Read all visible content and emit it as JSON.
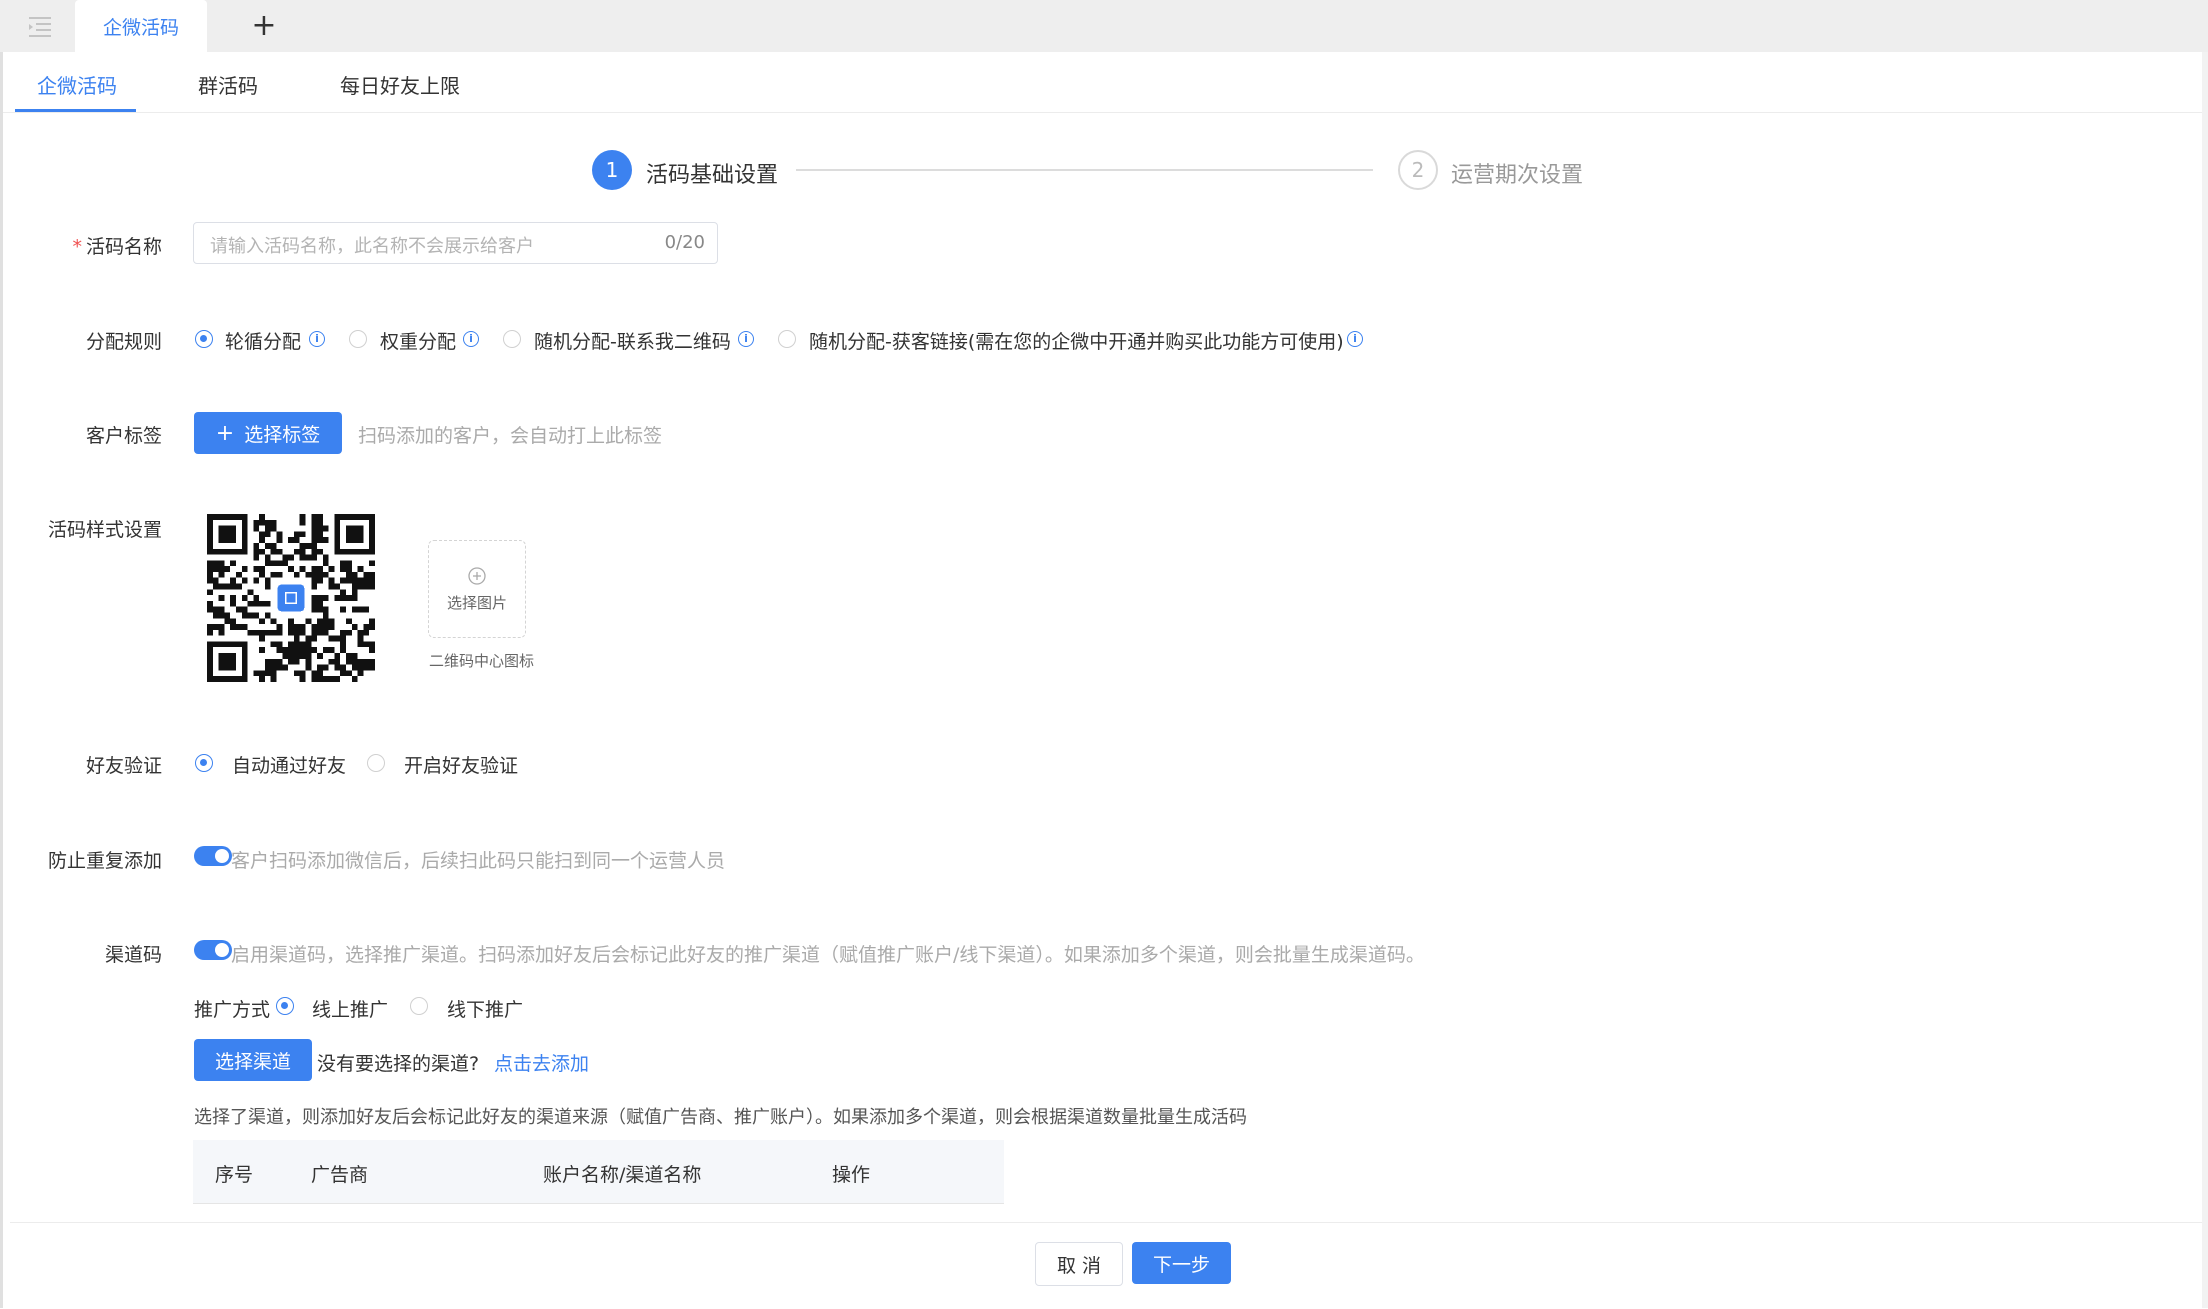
{
  "topbar": {
    "tab_label": "企微活码",
    "add_label": "+"
  },
  "subtabs": [
    "企微活码",
    "群活码",
    "每日好友上限"
  ],
  "steps": [
    {
      "num": "1",
      "label": "活码基础设置"
    },
    {
      "num": "2",
      "label": "运营期次设置"
    }
  ],
  "form": {
    "name": {
      "label": "活码名称",
      "required": "*",
      "placeholder": "请输入活码名称，此名称不会展示给客户",
      "counter": "0/20"
    },
    "rule": {
      "label": "分配规则",
      "options": [
        "轮循分配",
        "权重分配",
        "随机分配-联系我二维码",
        "随机分配-获客链接(需在您的企微中开通并购买此功能方可使用)"
      ],
      "selected_index": 0,
      "info_glyph": "i"
    },
    "tag": {
      "label": "客户标签",
      "button": "选择标签",
      "button_plus": "+",
      "hint": "扫码添加的客户，会自动打上此标签"
    },
    "style": {
      "label": "活码样式设置",
      "upload_label": "选择图片",
      "caption": "二维码中心图标"
    },
    "verify": {
      "label": "好友验证",
      "options": [
        "自动通过好友",
        "开启好友验证"
      ],
      "selected_index": 0
    },
    "dedupe": {
      "label": "防止重复添加",
      "enabled": true,
      "hint": "客户扫码添加微信后，后续扫此码只能扫到同一个运营人员"
    },
    "channel": {
      "label": "渠道码",
      "enabled": true,
      "hint": "启用渠道码，选择推广渠道。扫码添加好友后会标记此好友的推广渠道（赋值推广账户/线下渠道）。如果添加多个渠道，则会批量生成渠道码。",
      "promo_label": "推广方式",
      "promo_options": [
        "线上推广",
        "线下推广"
      ],
      "promo_selected": 0,
      "select_button": "选择渠道",
      "no_channel_text": "没有要选择的渠道?",
      "add_link": "点击去添加",
      "desc": "选择了渠道，则添加好友后会标记此好友的渠道来源（赋值广告商、推广账户）。如果添加多个渠道，则会根据渠道数量批量生成活码",
      "table_headers": [
        "序号",
        "广告商",
        "账户名称/渠道名称",
        "操作"
      ]
    }
  },
  "footer": {
    "cancel": "取 消",
    "next": "下一步"
  },
  "colors": {
    "accent": "#3c82f0",
    "required": "#f05050"
  }
}
